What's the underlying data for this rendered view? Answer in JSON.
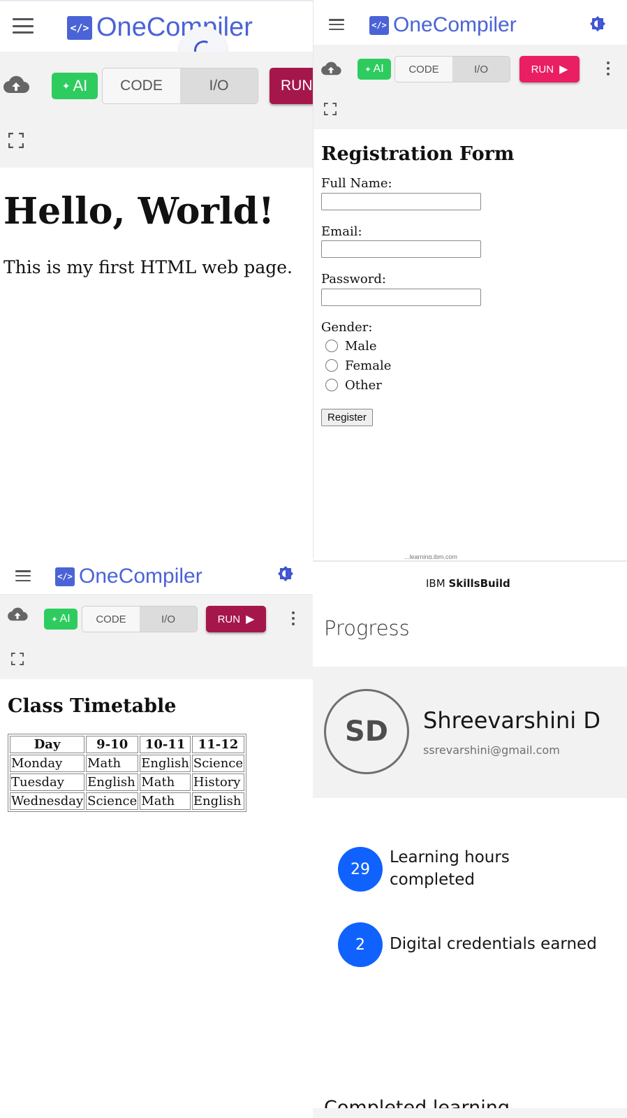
{
  "colors": {
    "brand_blue": "#4a63d6",
    "ai_green": "#2ecc5f",
    "run_crimson": "#a5174b",
    "run_pink": "#e91e63",
    "ibm_blue": "#0f62fe"
  },
  "compiler": {
    "logo_glyph": "</>",
    "logo_text": "OneCompiler",
    "ai_label": "AI",
    "tab_code": "CODE",
    "tab_io": "I/O",
    "run_label_cut": "RUN",
    "run_label": "RUN",
    "run_icon": "▶"
  },
  "panel1": {
    "heading": "Hello, World!",
    "paragraph": "This is my first HTML web page."
  },
  "panel2": {
    "title": "Registration Form",
    "fields": [
      {
        "label": "Full Name:"
      },
      {
        "label": "Email:"
      },
      {
        "label": "Password:"
      }
    ],
    "gender_label": "Gender:",
    "gender_options": [
      "Male",
      "Female",
      "Other"
    ],
    "submit_label": "Register",
    "url_fragment": "...learning.ibm.com"
  },
  "panel3": {
    "title": "Class Timetable",
    "headers": [
      "Day",
      "9-10",
      "10-11",
      "11-12"
    ],
    "rows": [
      [
        "Monday",
        "Math",
        "English",
        "Science"
      ],
      [
        "Tuesday",
        "English",
        "Math",
        "History"
      ],
      [
        "Wednesday",
        "Science",
        "Math",
        "English"
      ]
    ]
  },
  "skillsbuild": {
    "brand_ibm": "IBM",
    "brand_product": "SkillsBuild",
    "section_title": "Progress",
    "avatar_initials": "SD",
    "name": "Shreevarshini D",
    "email": "ssrevarshini@gmail.com",
    "stats": [
      {
        "value": "29",
        "label": "Learning hours completed"
      },
      {
        "value": "2",
        "label": "Digital credentials earned"
      }
    ],
    "cut_heading": "Completed learning"
  }
}
